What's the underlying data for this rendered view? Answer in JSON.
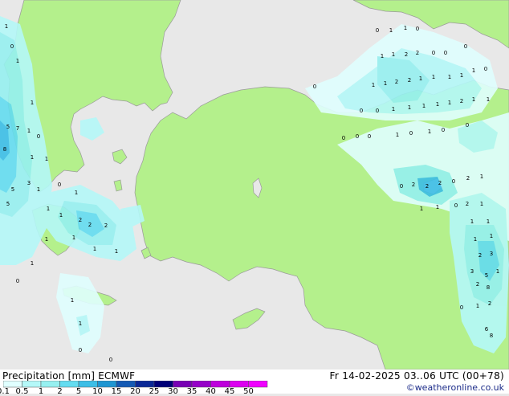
{
  "product": "Precipitation [mm]",
  "model": "ECMWF",
  "valid_time": "Fr 14-02-2025 03..06 UTC (00+78)",
  "credit": "©weatheronline.co.uk",
  "scale": {
    "ticks": [
      "0.1",
      "0.5",
      "1",
      "2",
      "5",
      "10",
      "15",
      "20",
      "25",
      "30",
      "35",
      "40",
      "45",
      "50"
    ],
    "colors": [
      "#e0ffff",
      "#b4f8f8",
      "#96f0f0",
      "#64dcf0",
      "#3cbee6",
      "#1e96d2",
      "#145ab4",
      "#0a2896",
      "#000078",
      "#7800b4",
      "#9600c8",
      "#be00dc",
      "#dc00f0",
      "#f000ff"
    ]
  },
  "colors": {
    "sea": "#e8e8e8",
    "land": "#b4f08c",
    "border": "#9a9a9a"
  },
  "precip_labels": [
    "0",
    "1",
    "2",
    "3",
    "4",
    "5",
    "6",
    "7",
    "8"
  ]
}
